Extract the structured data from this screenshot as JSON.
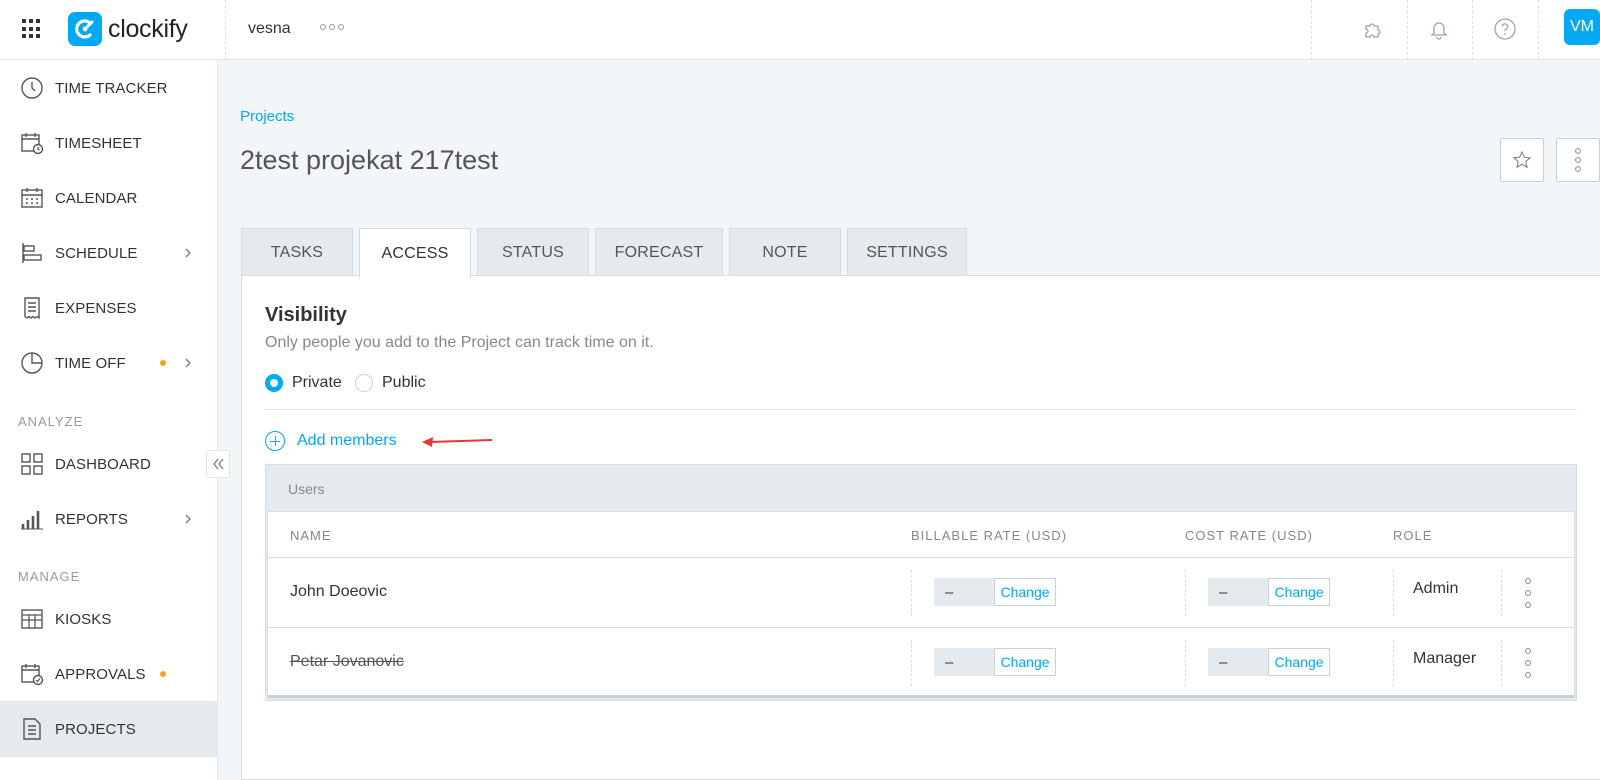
{
  "app": {
    "logo_text": "clockify",
    "workspace": "vesna",
    "avatar_initials": "VM",
    "accent_color": "#03a9f4"
  },
  "sidebar": {
    "items": [
      {
        "label": "TIME TRACKER",
        "icon": "clock-icon"
      },
      {
        "label": "TIMESHEET",
        "icon": "timesheet-icon"
      },
      {
        "label": "CALENDAR",
        "icon": "calendar-icon"
      },
      {
        "label": "SCHEDULE",
        "icon": "schedule-icon"
      },
      {
        "label": "EXPENSES",
        "icon": "receipt-icon"
      },
      {
        "label": "TIME OFF",
        "icon": "time-off-icon"
      },
      {
        "label": "DASHBOARD",
        "icon": "dashboard-icon"
      },
      {
        "label": "REPORTS",
        "icon": "reports-icon"
      },
      {
        "label": "KIOSKS",
        "icon": "kiosk-icon"
      },
      {
        "label": "APPROVALS",
        "icon": "approvals-icon"
      },
      {
        "label": "PROJECTS",
        "icon": "projects-icon"
      }
    ],
    "sections": {
      "analyze": "ANALYZE",
      "manage": "MANAGE"
    },
    "notification_dot_color": "#f7a21b"
  },
  "page": {
    "breadcrumb": "Projects",
    "title": "2test projekat 217test",
    "tabs": [
      "TASKS",
      "ACCESS",
      "STATUS",
      "FORECAST",
      "NOTE",
      "SETTINGS"
    ],
    "active_tab": "ACCESS"
  },
  "access": {
    "visibility_title": "Visibility",
    "visibility_desc": "Only people you add to the Project can track time on it.",
    "options": {
      "private": "Private",
      "public": "Public"
    },
    "selected": "Private",
    "add_members": "Add members",
    "users_heading": "Users",
    "columns": {
      "name": "NAME",
      "billable": "BILLABLE RATE (USD)",
      "cost": "COST RATE (USD)",
      "role": "ROLE"
    },
    "rows": [
      {
        "name": "John Doeovic",
        "billable": "–",
        "cost": "–",
        "role": "Admin",
        "change": "Change"
      },
      {
        "name": "Petar Jovanovic",
        "billable": "–",
        "cost": "–",
        "role": "Manager",
        "change": "Change"
      }
    ]
  }
}
